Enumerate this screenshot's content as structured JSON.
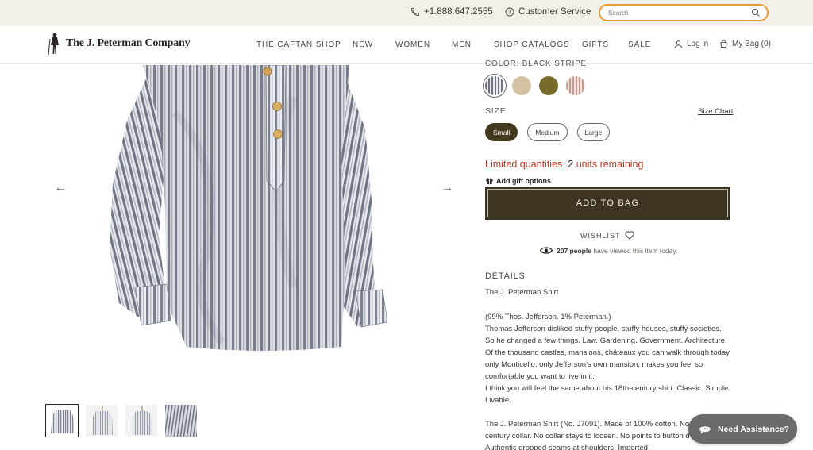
{
  "topbar": {
    "phone": "+1.888.647.2555",
    "customer_service": "Customer Service",
    "search_placeholder": "Search"
  },
  "header": {
    "logo_text": "The J. Peterman Company",
    "nav": [
      "THE CAFTAN SHOP",
      "NEW",
      "WOMEN",
      "MEN",
      "SHOP CATALOGS",
      "GIFTS",
      "SALE"
    ],
    "login": "Log in",
    "bag": "My Bag (0)"
  },
  "product": {
    "color_label": "COLOR: BLACK STRIPE",
    "swatch_colors": [
      "#8a8e98",
      "#d2c2a2",
      "#7a6a2c",
      "#e0bdb4"
    ],
    "size_label": "SIZE",
    "size_chart": "Size Chart",
    "sizes": [
      "Small",
      "Medium",
      "Large"
    ],
    "selected_size": "Small",
    "limited_prefix": "Limited quantities.",
    "limited_count": "2",
    "limited_suffix": "units remaining.",
    "gift": "Add gift options",
    "add_to_bag": "ADD TO BAG",
    "wishlist": "WISHLIST",
    "viewed_count": "207 people",
    "viewed_text": "have viewed this item today.",
    "details_title": "DETAILS",
    "details_name": "The J. Peterman Shirt",
    "description": [
      "(99% Thos. Jefferson. 1% Peterman.)",
      "Thomas Jefferson disliked stuffy people, stuffy houses, stuffy societies.",
      "So he changed a few things. Law. Gardening. Government. Architecture.",
      "Of the thousand castles, mansions, châteaux you can walk through today,",
      "only Monticello, only Jefferson's own mansion, makes you feel so",
      "comfortable you want to live in it.",
      "I think you will feel the same about his 18th-century shirt. Classic. Simple.",
      "Livable."
    ],
    "description2": [
      "The J. Peterman Shirt (No. J7091). Made of 100% cotton. Non-",
      "century collar. No collar stays to loosen. No points to button d",
      "Authentic dropped seams at shoulders. Imported."
    ]
  },
  "chat": {
    "label": "Need Assistance?"
  }
}
